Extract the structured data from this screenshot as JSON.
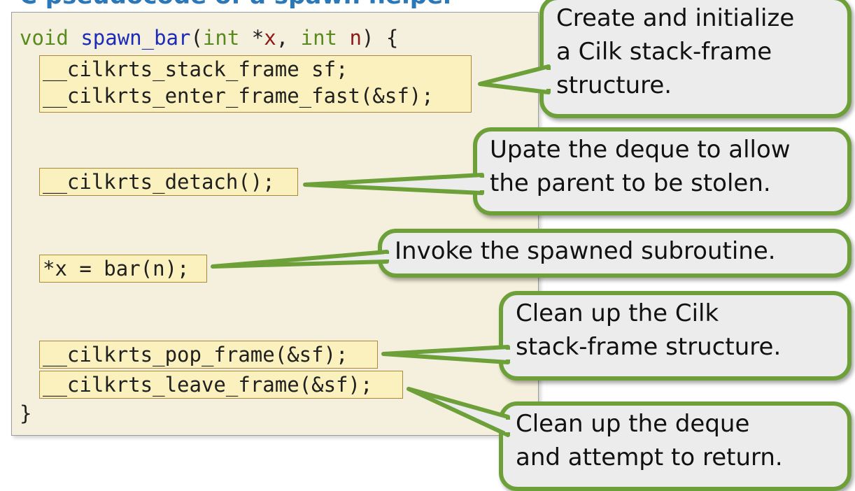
{
  "slide": {
    "title": "C pseudocode of a spawn helper"
  },
  "code": {
    "kw_void": "void",
    "fn_name": "spawn_bar",
    "open_paren": "(",
    "kw_int1": "int",
    "star_x": " *",
    "param_x": "x",
    "comma": ", ",
    "kw_int2": "int",
    "space_n": " ",
    "param_n": "n",
    "close_brace_open": ") {",
    "stack_frame_decl": "__cilkrts_stack_frame sf;",
    "enter_frame": "__cilkrts_enter_frame_fast(&sf);",
    "detach": "__cilkrts_detach();",
    "invoke": "*x = bar(n);",
    "pop_frame": "__cilkrts_pop_frame(&sf);",
    "leave_frame": "__cilkrts_leave_frame(&sf);",
    "closing_brace": "}"
  },
  "callouts": {
    "create": [
      "Create and initialize",
      "a Cilk stack-frame",
      "structure."
    ],
    "update_deque": [
      "Upate the deque to allow",
      "the parent to be stolen."
    ],
    "invoke": [
      "Invoke the spawned subroutine."
    ],
    "cleanup_frame": [
      "Clean up the Cilk",
      "stack-frame structure."
    ],
    "cleanup_deque": [
      "Clean up the deque",
      "and attempt to return."
    ]
  },
  "colors": {
    "callout_border": "#6ea03a",
    "callout_fill": "#ececec",
    "code_panel": "#f5f0dd",
    "code_box": "#fbf1bf",
    "title": "#2b78b8"
  }
}
